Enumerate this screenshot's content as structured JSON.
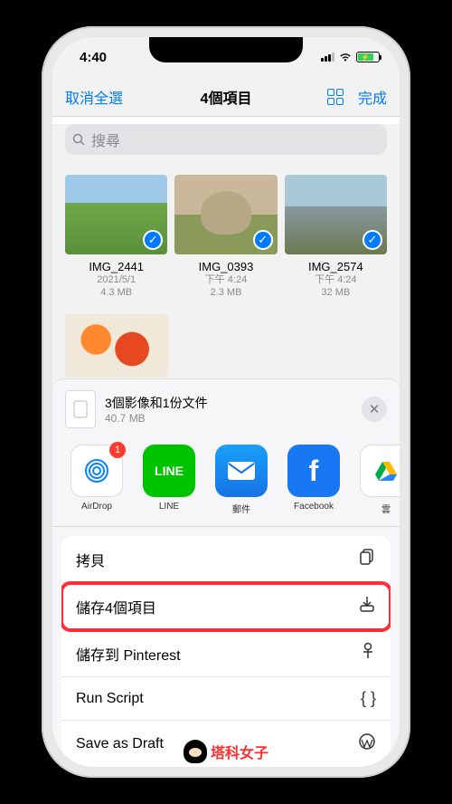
{
  "status": {
    "time": "4:40"
  },
  "nav": {
    "cancel": "取消全選",
    "title": "4個項目",
    "done": "完成"
  },
  "search": {
    "placeholder": "搜尋"
  },
  "files": [
    {
      "name": "IMG_2441",
      "line1": "2021/5/1",
      "line2": "4.3 MB"
    },
    {
      "name": "IMG_0393",
      "line1": "下午 4:24",
      "line2": "2.3 MB"
    },
    {
      "name": "IMG_2574",
      "line1": "下午 4:24",
      "line2": "32 MB"
    }
  ],
  "sheet": {
    "title": "3個影像和1份文件",
    "size": "40.7 MB"
  },
  "apps": [
    {
      "label": "AirDrop",
      "badge": "1"
    },
    {
      "label": "LINE"
    },
    {
      "label": "郵件"
    },
    {
      "label": "Facebook"
    },
    {
      "label": "雲"
    }
  ],
  "actions": {
    "copy": "拷貝",
    "save_items": "儲存4個項目",
    "save_pinterest": "儲存到 Pinterest",
    "run_script": "Run Script",
    "save_draft": "Save as Draft"
  },
  "watermark": "塔科女子"
}
